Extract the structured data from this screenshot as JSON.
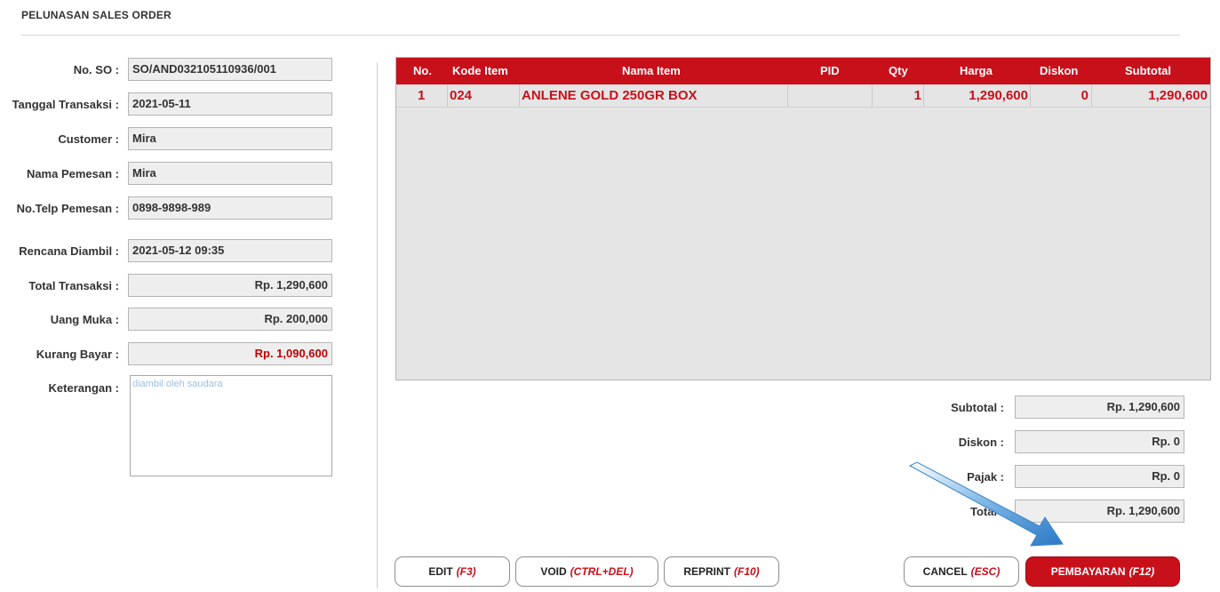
{
  "page": {
    "title": "PELUNASAN SALES ORDER"
  },
  "form": {
    "no_so": {
      "label": "No. SO :",
      "value": "SO/AND032105110936/001"
    },
    "tanggal": {
      "label": "Tanggal Transaksi :",
      "value": "2021-05-11"
    },
    "customer": {
      "label": "Customer :",
      "value": "Mira"
    },
    "nama_pemesan": {
      "label": "Nama Pemesan :",
      "value": "Mira"
    },
    "telp": {
      "label": "No.Telp Pemesan :",
      "value": "0898-9898-989"
    },
    "rencana": {
      "label": "Rencana Diambil :",
      "value": "2021-05-12 09:35"
    },
    "total": {
      "label": "Total Transaksi :",
      "value": "Rp. 1,290,600"
    },
    "uang_muka": {
      "label": "Uang Muka :",
      "value": "Rp. 200,000"
    },
    "kurang": {
      "label": "Kurang Bayar :",
      "value": "Rp. 1,090,600"
    },
    "keterangan": {
      "label": "Keterangan :",
      "value": "diambil oleh saudara"
    }
  },
  "table": {
    "columns": [
      "No.",
      "Kode Item",
      "Nama Item",
      "PID",
      "Qty",
      "Harga",
      "Diskon",
      "Subtotal"
    ],
    "rows": [
      {
        "no": "1",
        "kode": "024",
        "nama": "ANLENE GOLD 250GR BOX",
        "pid": "",
        "qty": "1",
        "harga": "1,290,600",
        "diskon": "0",
        "subtotal": "1,290,600"
      }
    ]
  },
  "totals": {
    "subtotal": {
      "label": "Subtotal :",
      "value": "Rp. 1,290,600"
    },
    "diskon": {
      "label": "Diskon :",
      "value": "Rp. 0"
    },
    "pajak": {
      "label": "Pajak :",
      "value": "Rp. 0"
    },
    "total": {
      "label": "Total :",
      "value": "Rp. 1,290,600"
    }
  },
  "buttons": {
    "edit": {
      "label": "EDIT",
      "key": "(F3)"
    },
    "void": {
      "label": "VOID",
      "key": "(CTRL+DEL)"
    },
    "reprint": {
      "label": "REPRINT",
      "key": "(F10)"
    },
    "cancel": {
      "label": "CANCEL",
      "key": "(ESC)"
    },
    "pembayaran": {
      "label": "PEMBAYARAN",
      "key": "(F12)"
    }
  },
  "colors": {
    "accent": "#c8101b",
    "field_bg": "#eeeeee",
    "annotation_arrow": "#3a86c8"
  },
  "icons": {
    "annotation": "arrow-pointer-icon"
  }
}
